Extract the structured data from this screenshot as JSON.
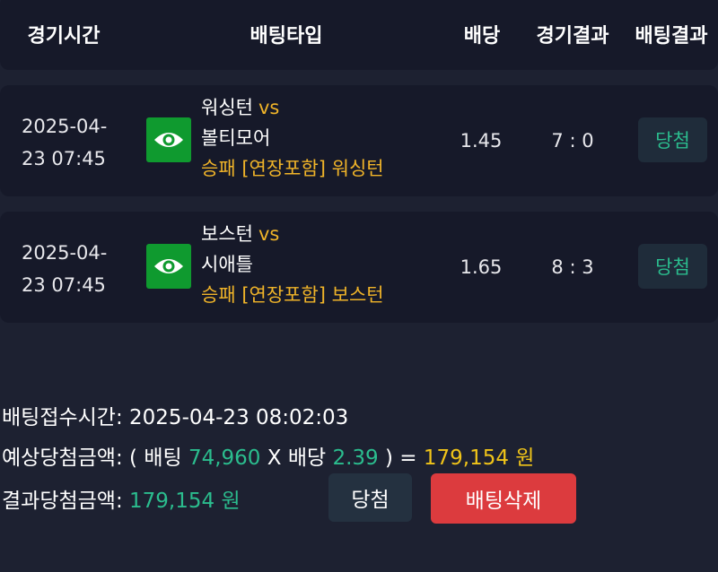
{
  "header": {
    "col_time": "경기시간",
    "col_type": "배팅타입",
    "col_odds": "배당",
    "col_game_result": "경기결과",
    "col_bet_result": "배팅결과"
  },
  "bets": [
    {
      "time_line1": "2025-04-",
      "time_line2": "23 07:45",
      "home": "워싱턴",
      "vs": "vs",
      "away": "볼티모어",
      "pick": "승패 [연장포함] 워싱턴",
      "odds": "1.45",
      "score": "7 : 0",
      "result": "당첨",
      "icon": "eye-icon"
    },
    {
      "time_line1": "2025-04-",
      "time_line2": "23 07:45",
      "home": "보스턴",
      "vs": "vs",
      "away": "시애틀",
      "pick": "승패 [연장포함] 보스턴",
      "odds": "1.65",
      "score": "8 : 3",
      "result": "당첨",
      "icon": "eye-icon"
    }
  ],
  "summary": {
    "received_label": "배팅접수시간:",
    "received_value": "2025-04-23 08:02:03",
    "expected_label": "예상당첨금액:",
    "expected_open": "( 배팅",
    "stake": "74,960",
    "times_label": "X 배당",
    "total_odds": "2.39",
    "expected_eq": ") =",
    "expected_amount": "179,154 원",
    "final_label": "결과당첨금액:",
    "final_amount": "179,154 원"
  },
  "buttons": {
    "result_label": "당첨",
    "delete_label": "배팅삭제"
  },
  "colors": {
    "background": "#1d2131",
    "card": "#161929",
    "accent_yellow": "#f0b429",
    "accent_green": "#2bbd8e",
    "eye_green": "#0f9a2f",
    "delete_red": "#dc3b3e"
  }
}
